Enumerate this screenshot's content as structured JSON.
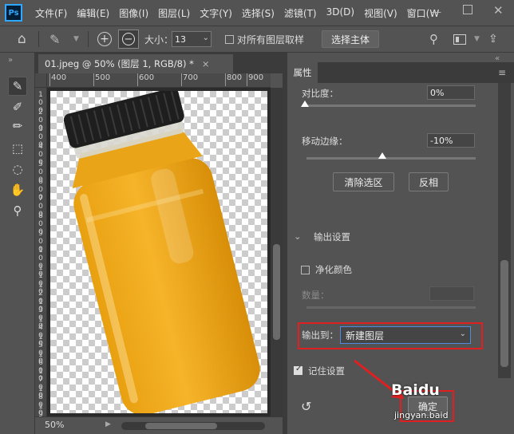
{
  "app": {
    "logo_text": "Ps",
    "menu": [
      "文件(F)",
      "编辑(E)",
      "图像(I)",
      "图层(L)",
      "文字(Y)",
      "选择(S)",
      "滤镜(T)",
      "3D(D)",
      "视图(V)",
      "窗口(W"
    ],
    "window_controls": {
      "minimize": "—",
      "close": "✕"
    }
  },
  "options_bar": {
    "size_label": "大小：",
    "size_value": "13",
    "sample_all_label": "对所有图层取样",
    "select_subject_label": "选择主体"
  },
  "document": {
    "tab_title": "01.jpeg @ 50% (图层 1, RGB/8) *",
    "tab_close": "×",
    "ruler_top": [
      "400",
      "500",
      "600",
      "700",
      "800",
      "900"
    ],
    "ruler_left": [
      "1\n0\n0",
      "2\n0\n0",
      "3\n0\n0",
      "4\n0\n0",
      "5\n0\n0",
      "6\n0\n0",
      "7\n0\n0",
      "8\n0\n0",
      "9\n0\n0",
      "1\n0\n0\n0",
      "1\n1\n0\n0",
      "1\n2\n0\n0",
      "1\n3\n0\n0",
      "1\n4\n0\n0",
      "1\n5\n0\n0",
      "1\n6\n0\n0",
      "1\n7\n0\n0",
      "1\n8\n0\n0",
      "1\n9\n0\n0"
    ],
    "zoom": "50%"
  },
  "properties_panel": {
    "tab_label": "属性",
    "contrast_label": "对比度：",
    "contrast_value": "0%",
    "shift_edge_label": "移动边缘：",
    "shift_edge_value": "-10%",
    "shift_edge_slider_fraction": 0.45,
    "clear_selection_label": "清除选区",
    "invert_label": "反相",
    "output_settings_label": "输出设置",
    "decontaminate_label": "净化颜色",
    "amount_label": "数量：",
    "output_to_label": "输出到：",
    "output_to_value": "新建图层",
    "remember_label": "记住设置",
    "ok_label": "确定"
  },
  "watermark": {
    "logo": "Baidu",
    "text": "jingyan.baid"
  },
  "colors": {
    "annotation": "#e02020",
    "focus": "#4f8ae0",
    "bottle_cap": "#1e1e1e",
    "juice": "#f0a818"
  }
}
